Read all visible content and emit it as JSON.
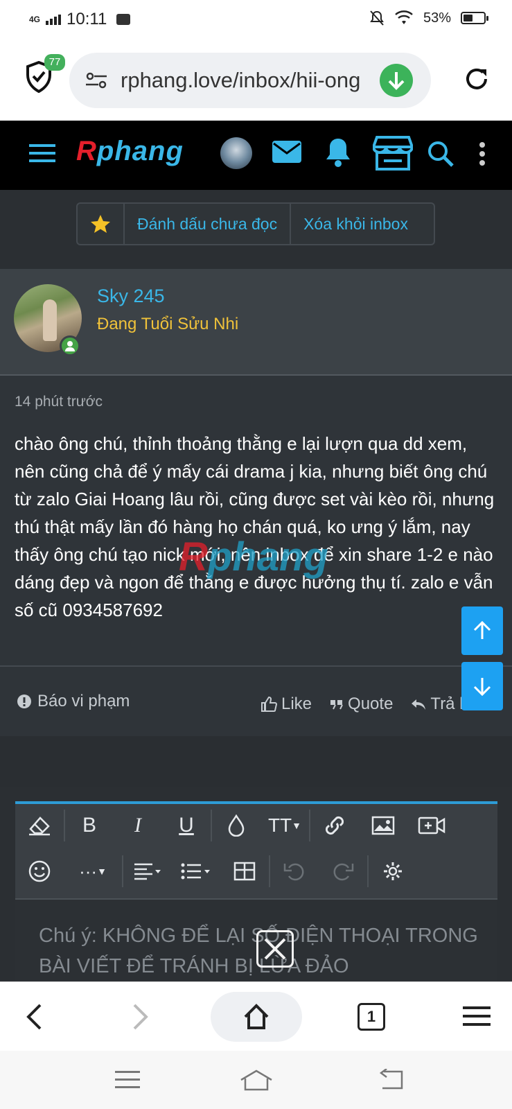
{
  "status_bar": {
    "network": "4G",
    "time": "10:11",
    "battery": "53%",
    "battery_level": 0.53
  },
  "browser": {
    "url": "rphang.love/inbox/hii-ong",
    "shield_count": "77",
    "tab_count": "1"
  },
  "site": {
    "logo_first": "R",
    "logo_rest": "phang"
  },
  "actions": {
    "mark_unread": "Đánh dấu chưa đọc",
    "remove_inbox": "Xóa khỏi inbox"
  },
  "message": {
    "username": "Sky 245",
    "user_title": "Đang Tuổi Sửu Nhi",
    "time_ago": "14 phút trước",
    "body": "chào ông chú, thỉnh thoảng thằng e lại lượn qua dd xem, nên cũng chả để ý mấy cái drama j kia, nhưng biết ông chú từ zalo Giai Hoang lâu rồi, cũng được set vài kèo rồi, nhưng thú thật mấy lần đó hàng họ chán quá, ko ưng ý lắm, nay thấy ông chú tạo nick mới, nên inbox để xin share 1-2 e nào dáng đẹp và ngon để thằng e được hưởng thụ tí. zalo e vẫn số cũ 0934587692",
    "report": "Báo vi phạm",
    "like": "Like",
    "quote": "Quote",
    "reply": "Trả lời"
  },
  "editor": {
    "placeholder": "Chú ý: KHÔNG ĐỂ LẠI SỐ ĐIỆN THOẠI TRONG BÀI VIẾT ĐỂ TRÁNH BỊ LỪA ĐẢO",
    "bold": "B",
    "italic": "I",
    "underline": "U",
    "text_size": "TT",
    "more": "···"
  },
  "colors": {
    "accent": "#3ab7e8",
    "user_title": "#f0c23a",
    "scroll_button": "#1da1f2",
    "online": "#45a346"
  }
}
